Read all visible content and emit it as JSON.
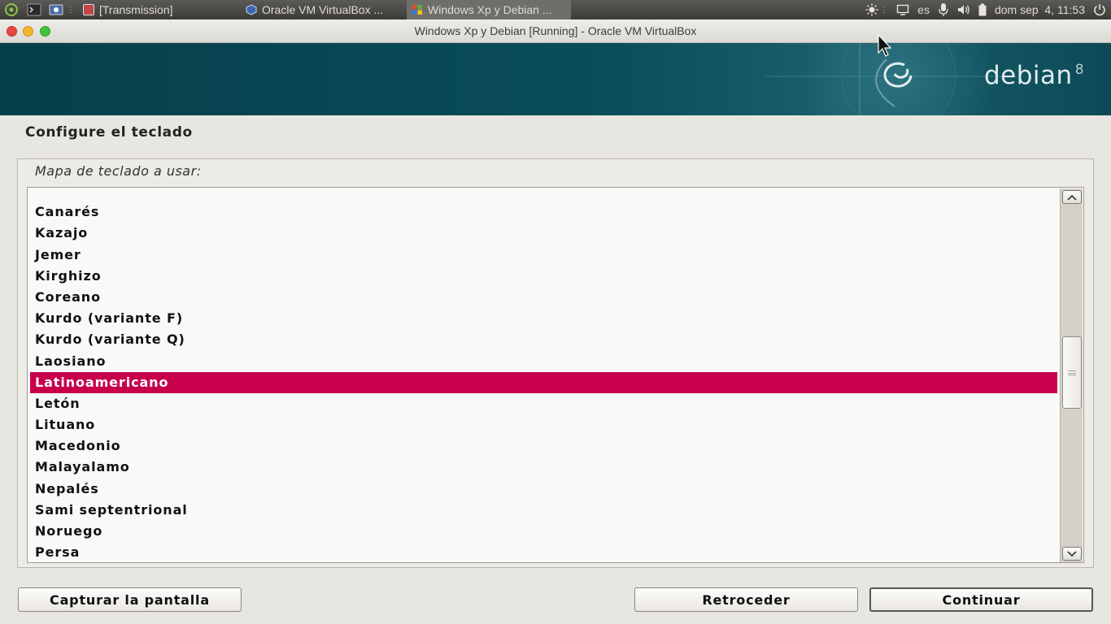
{
  "top_panel": {
    "tasks": [
      {
        "label": "[Transmission]"
      },
      {
        "label": "Oracle VM VirtualBox ..."
      },
      {
        "label": "Windows Xp y Debian ..."
      }
    ],
    "keyboard_layout": "es",
    "clock": "dom sep  4, 11:53"
  },
  "window": {
    "title": "Windows Xp y Debian [Running] - Oracle VM VirtualBox"
  },
  "banner": {
    "logo_text": "debian",
    "logo_version": "8"
  },
  "installer": {
    "page_title": "Configure el teclado",
    "list_label": "Mapa de teclado a usar:",
    "items": [
      "Canarés",
      "Kazajo",
      "Jemer",
      "Kirghizo",
      "Coreano",
      "Kurdo (variante F)",
      "Kurdo (variante Q)",
      "Laosiano",
      "Latinoamericano",
      "Letón",
      "Lituano",
      "Macedonio",
      "Malayalamo",
      "Nepalés",
      "Sami septentrional",
      "Noruego",
      "Persa"
    ],
    "selected_item": "Latinoamericano",
    "scroll_position": 0.49,
    "buttons": {
      "screenshot": "Capturar la pantalla",
      "back": "Retroceder",
      "continue": "Continuar"
    }
  },
  "colors": {
    "selection": "#c8004c",
    "banner": "#0a4d5b"
  }
}
